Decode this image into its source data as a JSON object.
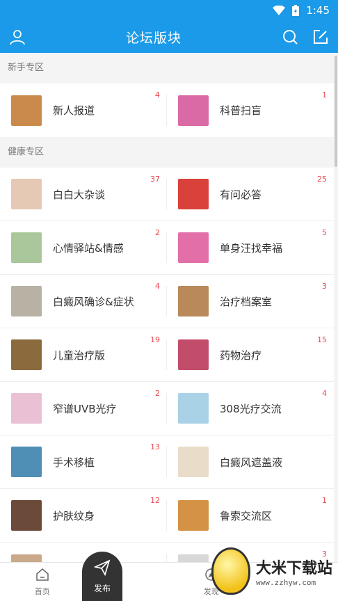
{
  "status": {
    "time": "1:45"
  },
  "header": {
    "title": "论坛版块"
  },
  "sections": [
    {
      "title": "新手专区",
      "items": [
        {
          "label": "新人报道",
          "count": "4",
          "thumb": "#c98a4b"
        },
        {
          "label": "科普扫盲",
          "count": "1",
          "thumb": "#d96aa5"
        }
      ]
    },
    {
      "title": "健康专区",
      "items": [
        {
          "label": "白白大杂谈",
          "count": "37",
          "thumb": "#e6c9b5"
        },
        {
          "label": "有问必答",
          "count": "25",
          "thumb": "#d9423a"
        },
        {
          "label": "心情驿站&情感",
          "count": "2",
          "thumb": "#a9c79a"
        },
        {
          "label": "单身汪找幸福",
          "count": "5",
          "thumb": "#e26fa8"
        },
        {
          "label": "白癜风确诊&症状",
          "count": "4",
          "thumb": "#b7b2a4"
        },
        {
          "label": "治疗档案室",
          "count": "3",
          "thumb": "#b9895a"
        },
        {
          "label": "儿童治疗版",
          "count": "19",
          "thumb": "#8b6a3d"
        },
        {
          "label": "药物治疗",
          "count": "15",
          "thumb": "#c24d6a"
        },
        {
          "label": "窄谱UVB光疗",
          "count": "2",
          "thumb": "#e9c0d4"
        },
        {
          "label": "308光疗交流",
          "count": "4",
          "thumb": "#a9d2e6"
        },
        {
          "label": "手术移植",
          "count": "13",
          "thumb": "#4f8fb5"
        },
        {
          "label": "白癜风遮盖液",
          "count": "",
          "thumb": "#e9ddc9"
        },
        {
          "label": "护肤纹身",
          "count": "12",
          "thumb": "#6b4a3a"
        },
        {
          "label": "鲁索交流区",
          "count": "1",
          "thumb": "#d49245"
        },
        {
          "label": "",
          "count": "",
          "thumb": "#caa98a"
        },
        {
          "label": "",
          "count": "3",
          "thumb": "#d8d8d8"
        }
      ]
    }
  ],
  "tabs": {
    "home": "首页",
    "publish": "发布",
    "discover": "发现"
  },
  "watermark": {
    "title": "大米下载站",
    "url": "www.zzhyw.com"
  }
}
